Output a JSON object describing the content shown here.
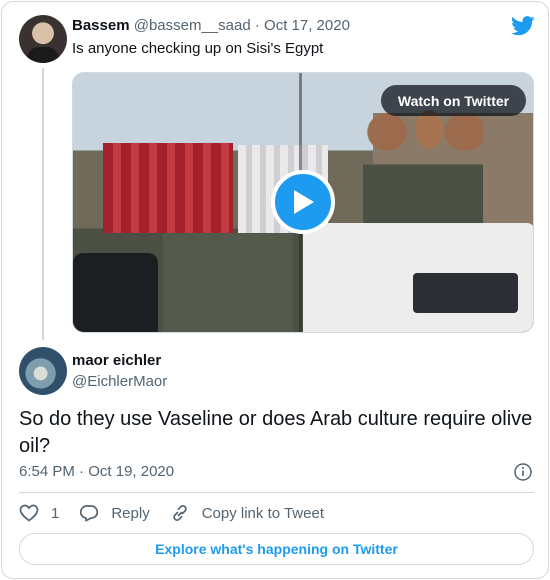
{
  "parent_tweet": {
    "author_name": "Bassem",
    "author_handle": "@bassem__saad",
    "separator": "·",
    "date": "Oct 17, 2020",
    "text": "Is anyone checking up on Sisi's Egypt",
    "media": {
      "watch_label": "Watch on Twitter",
      "play_icon": "play-icon"
    }
  },
  "main_tweet": {
    "author_name": "maor eichler",
    "author_handle": "@EichlerMaor",
    "text": "So do they use Vaseline or does Arab culture require olive oil?",
    "time": "6:54 PM",
    "separator": "·",
    "date": "Oct 19, 2020"
  },
  "actions": {
    "like_count": "1",
    "reply_label": "Reply",
    "copy_link_label": "Copy link to Tweet"
  },
  "footer": {
    "explore_label": "Explore what's happening on Twitter"
  },
  "colors": {
    "accent": "#1d9bf0",
    "secondary_text": "#536471",
    "border": "#cfd9de"
  }
}
